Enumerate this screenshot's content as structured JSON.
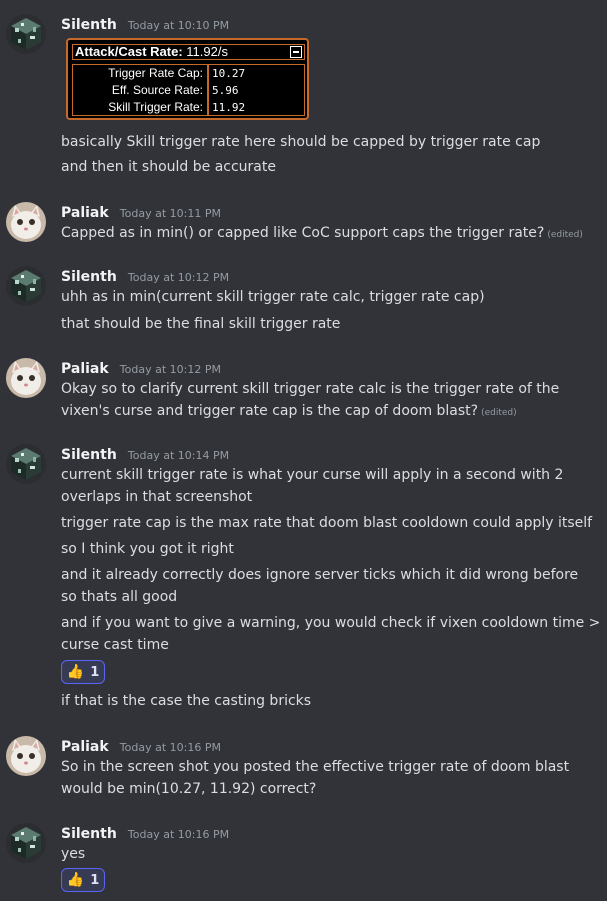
{
  "embed": {
    "title_label": "Attack/Cast Rate:",
    "title_value": "11.92/s",
    "rows": [
      {
        "label": "Trigger Rate Cap:",
        "value": "10.27"
      },
      {
        "label": "Eff. Source Rate:",
        "value": "5.96"
      },
      {
        "label": "Skill Trigger Rate:",
        "value": "11.92"
      }
    ]
  },
  "messages": [
    {
      "author": "Silenth",
      "time": "Today at 10:10 PM",
      "lines": [
        "basically Skill trigger rate here should be capped by trigger rate cap",
        "and then it should be accurate"
      ]
    },
    {
      "author": "Paliak",
      "time": "Today at 10:11 PM",
      "lines": [
        "Capped as in min() or capped like CoC support caps the trigger rate?"
      ],
      "edited": "(edited)"
    },
    {
      "author": "Silenth",
      "time": "Today at 10:12 PM",
      "lines": [
        "uhh as in min(current skill trigger rate calc, trigger rate cap)",
        "that should be the final skill trigger rate"
      ]
    },
    {
      "author": "Paliak",
      "time": "Today at 10:12 PM",
      "lines": [
        "Okay so to clarify current skill trigger rate calc  is the trigger rate of the",
        "vixen's curse and trigger rate cap is the cap of doom blast?"
      ],
      "edited": "(edited)"
    },
    {
      "author": "Silenth",
      "time": "Today at 10:14 PM",
      "lines": [
        "current skill trigger rate is what your curse will apply in a second with 2",
        "overlaps in that screenshot",
        "trigger rate cap is the max rate that doom blast cooldown could apply itself",
        "so I think you got it right",
        "and it already correctly does ignore server ticks which it did wrong before",
        "so thats all good",
        "and if you want to give a warning, you would check if vixen cooldown time >",
        "curse cast time",
        "if that is the case the casting bricks"
      ],
      "reaction_count": "1"
    },
    {
      "author": "Paliak",
      "time": "Today at 10:16 PM",
      "lines": [
        "So in the screen shot you posted the effective trigger rate of doom blast",
        "would be min(10.27, 11.92) correct?"
      ]
    },
    {
      "author": "Silenth",
      "time": "Today at 10:16 PM",
      "lines": [
        "yes"
      ],
      "reaction_count": "1"
    }
  ],
  "reaction_emoji": "👍",
  "colors": {
    "background": "#313338",
    "username": "#f2f3f5",
    "text": "#dbdee1",
    "timestamp": "#949ba4",
    "embed_border": "#c66a2c",
    "reaction_border": "#5865f2"
  }
}
